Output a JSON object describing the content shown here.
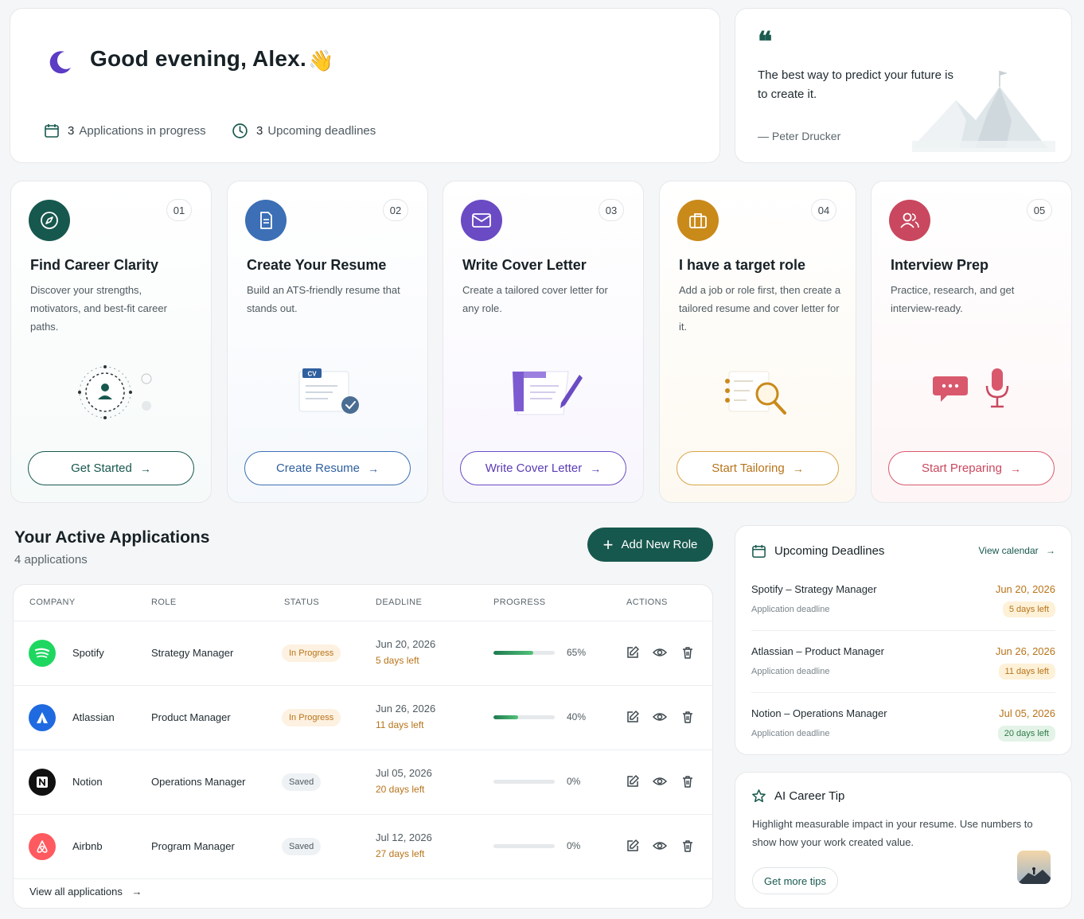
{
  "greeting": {
    "title": "Good evening, Alex.",
    "wave_emoji": "👋",
    "stats": [
      {
        "count": "3",
        "label": "Applications in progress",
        "icon": "calendar-icon"
      },
      {
        "count": "3",
        "label": "Upcoming deadlines",
        "icon": "clock-icon"
      }
    ]
  },
  "quote": {
    "mark": "❝",
    "text": "The best way to predict your future is to create it.",
    "author": "— Peter Drucker"
  },
  "steps": [
    {
      "num": "01",
      "title": "Find Career Clarity",
      "desc": "Discover your strengths, motivators, and best-fit career paths.",
      "button": "Get Started",
      "accent": "#17584e",
      "icon": "compass-icon"
    },
    {
      "num": "02",
      "title": "Create Your Resume",
      "desc": "Build an ATS-friendly resume that stands out.",
      "button": "Create Resume",
      "accent": "#2f5f9e",
      "icon": "document-icon"
    },
    {
      "num": "03",
      "title": "Write Cover Letter",
      "desc": "Create a tailored cover letter for any role.",
      "button": "Write Cover Letter",
      "accent": "#6a4bc4",
      "icon": "envelope-icon"
    },
    {
      "num": "04",
      "title": "I have a target role",
      "desc": "Add a job or role first, then create a tailored resume and cover letter for it.",
      "button": "Start Tailoring",
      "accent": "#c98a1a",
      "icon": "briefcase-icon"
    },
    {
      "num": "05",
      "title": "Interview Prep",
      "desc": "Practice, research, and get interview-ready.",
      "button": "Start Preparing",
      "accent": "#c9485f",
      "icon": "people-icon"
    }
  ],
  "art": {
    "cv_tag": "CV"
  },
  "applications": {
    "title": "Your Active Applications",
    "count_label": "4 applications",
    "add_button": "Add New Role",
    "headers": [
      "COMPANY",
      "ROLE",
      "STATUS",
      "DEADLINE",
      "PROGRESS",
      "ACTIONS"
    ],
    "rows": [
      {
        "company": "Spotify",
        "role": "Strategy Manager",
        "status": "In Progress",
        "date": "Jun 20, 2026",
        "days_left": "5 days left",
        "progress": 0.65,
        "progress_label": "65%"
      },
      {
        "company": "Atlassian",
        "role": "Product Manager",
        "status": "In Progress",
        "date": "Jun 26, 2026",
        "days_left": "11 days left",
        "progress": 0.4,
        "progress_label": "40%"
      },
      {
        "company": "Notion",
        "role": "Operations Manager",
        "status": "Saved",
        "date": "Jul 05, 2026",
        "days_left": "20 days left",
        "progress": 0,
        "progress_label": "0%"
      },
      {
        "company": "Airbnb",
        "role": "Program Manager",
        "status": "Saved",
        "date": "Jul 12, 2026",
        "days_left": "27 days left",
        "progress": 0,
        "progress_label": "0%"
      }
    ],
    "view_all": "View all applications"
  },
  "deadlines": {
    "title": "Upcoming Deadlines",
    "link": "View calendar",
    "items": [
      {
        "title": "Spotify – Strategy Manager",
        "sub": "Application deadline",
        "date": "Jun 20, 2026",
        "badge": "5 days left"
      },
      {
        "title": "Atlassian – Product Manager",
        "sub": "Application deadline",
        "date": "Jun 26, 2026",
        "badge": "11 days left"
      },
      {
        "title": "Notion – Operations Manager",
        "sub": "Application deadline",
        "date": "Jul 05, 2026",
        "badge": "20 days left"
      }
    ]
  },
  "tip": {
    "title": "AI Career Tip",
    "text": "Highlight measurable impact in your resume. Use numbers to show how your work created value.",
    "button": "Get more tips"
  },
  "colors": {
    "brand": "#17584e",
    "warning": "#b8741a",
    "progress_green": "#2e9a5e"
  }
}
